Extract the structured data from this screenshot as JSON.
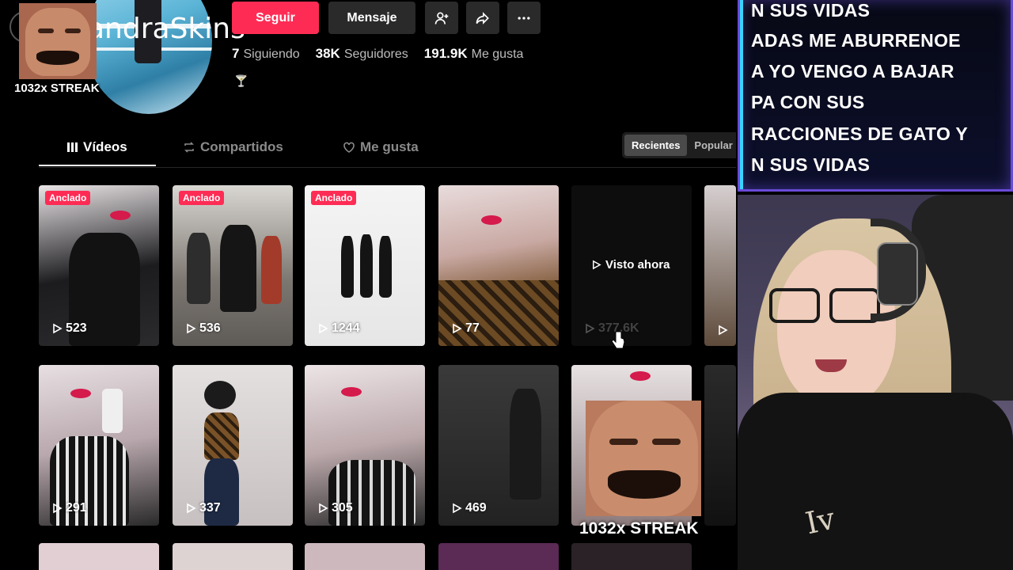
{
  "profile": {
    "username_partial": "andraSkins",
    "streak_badge": "1032x STREAK"
  },
  "actions": {
    "follow_label": "Seguir",
    "message_label": "Mensaje"
  },
  "stats": {
    "following_count": "7",
    "following_label": "Siguiendo",
    "followers_count": "38K",
    "followers_label": "Seguidores",
    "likes_count": "191.9K",
    "likes_label": "Me gusta"
  },
  "tabs": [
    {
      "label": "Vídeos",
      "active": true
    },
    {
      "label": "Compartidos",
      "active": false
    },
    {
      "label": "Me gusta",
      "active": false
    }
  ],
  "sort": {
    "recent_label": "Recientes",
    "popular_label": "Popular"
  },
  "videos": [
    {
      "views": "523",
      "pinned": "Anclado"
    },
    {
      "views": "536",
      "pinned": "Anclado"
    },
    {
      "views": "1244",
      "pinned": "Anclado"
    },
    {
      "views": "77"
    },
    {
      "seen_label": "Visto ahora",
      "views": "377.6K"
    },
    {
      "views": "291"
    },
    {
      "views": "337"
    },
    {
      "views": "305"
    },
    {
      "views": "469"
    }
  ],
  "overlay": {
    "chat_lines": [
      "N SUS VIDAS",
      "ADAS ME ABURRENOE",
      "A YO VENGO A BAJAR",
      "PA CON SUS",
      "RACCIONES DE GATO Y",
      "N SUS VIDAS"
    ],
    "meme_streak": "1032x STREAK"
  },
  "colors": {
    "follow_button": "#fe2c55",
    "pinned_badge": "#fe2c55",
    "overlay_border": "#6a4bd8"
  }
}
